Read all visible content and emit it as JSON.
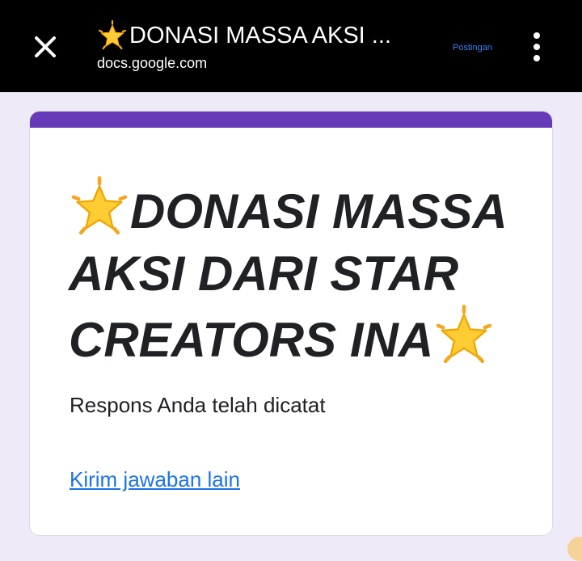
{
  "topbar": {
    "title": "DONASI MASSA AKSI ...",
    "url": "docs.google.com",
    "post_label": "Postingan",
    "close_icon": "close-icon",
    "menu_icon": "more-vert-icon"
  },
  "form": {
    "title": "DONASI MASSA AKSI DARI STAR CREATORS INA",
    "confirmation": "Respons Anda telah dicatat",
    "submit_another": "Kirim jawaban lain",
    "accent_color": "#673ab7"
  }
}
